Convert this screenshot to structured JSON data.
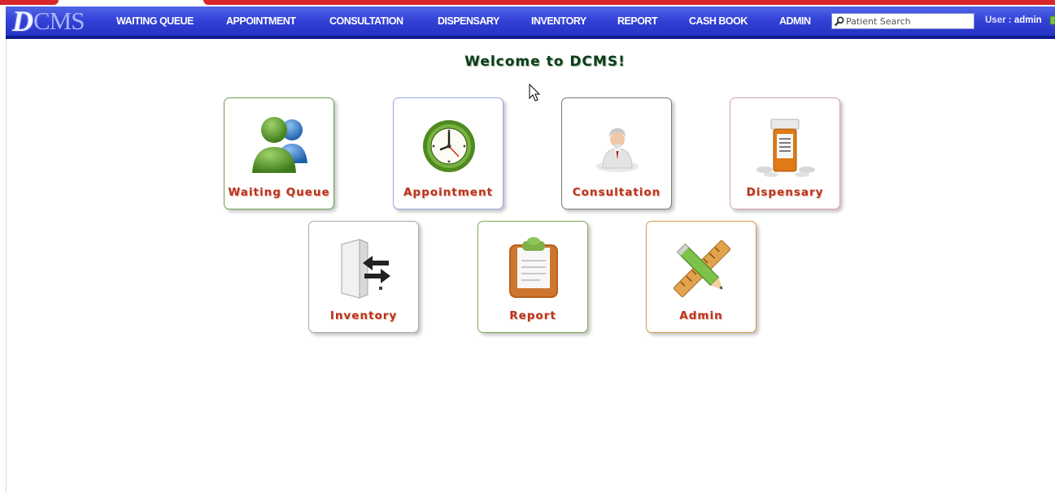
{
  "app": {
    "logo_initial": "D",
    "logo_rest": "CMS"
  },
  "nav": {
    "items": [
      {
        "label": "WAITING QUEUE"
      },
      {
        "label": "APPOINTMENT"
      },
      {
        "label": "CONSULTATION"
      },
      {
        "label": "DISPENSARY"
      },
      {
        "label": "INVENTORY"
      },
      {
        "label": "REPORT"
      },
      {
        "label": "CASH BOOK"
      },
      {
        "label": "ADMIN"
      }
    ],
    "search": {
      "placeholder": "Patient Search",
      "value": ""
    },
    "user": {
      "prefix": "User :",
      "name": "admin"
    }
  },
  "main": {
    "welcome": "Welcome to DCMS!",
    "tiles": [
      {
        "label": "Waiting Queue",
        "icon": "users-icon",
        "border_color": "#6aa14f"
      },
      {
        "label": "Appointment",
        "icon": "clock-icon",
        "border_color": "#9ca6de"
      },
      {
        "label": "Consultation",
        "icon": "doctor-icon",
        "border_color": "#7b7b7b"
      },
      {
        "label": "Dispensary",
        "icon": "pill-bottle-icon",
        "border_color": "#dba3ac"
      },
      {
        "label": "Inventory",
        "icon": "transfer-icon",
        "border_color": "#a9a9a9"
      },
      {
        "label": "Report",
        "icon": "clipboard-icon",
        "border_color": "#7fae53"
      },
      {
        "label": "Admin",
        "icon": "tools-icon",
        "border_color": "#d79a4e"
      }
    ]
  },
  "colors": {
    "nav_bg": "#3542d8",
    "tile_label": "#b9341e",
    "welcome_text": "#0b3d17"
  }
}
